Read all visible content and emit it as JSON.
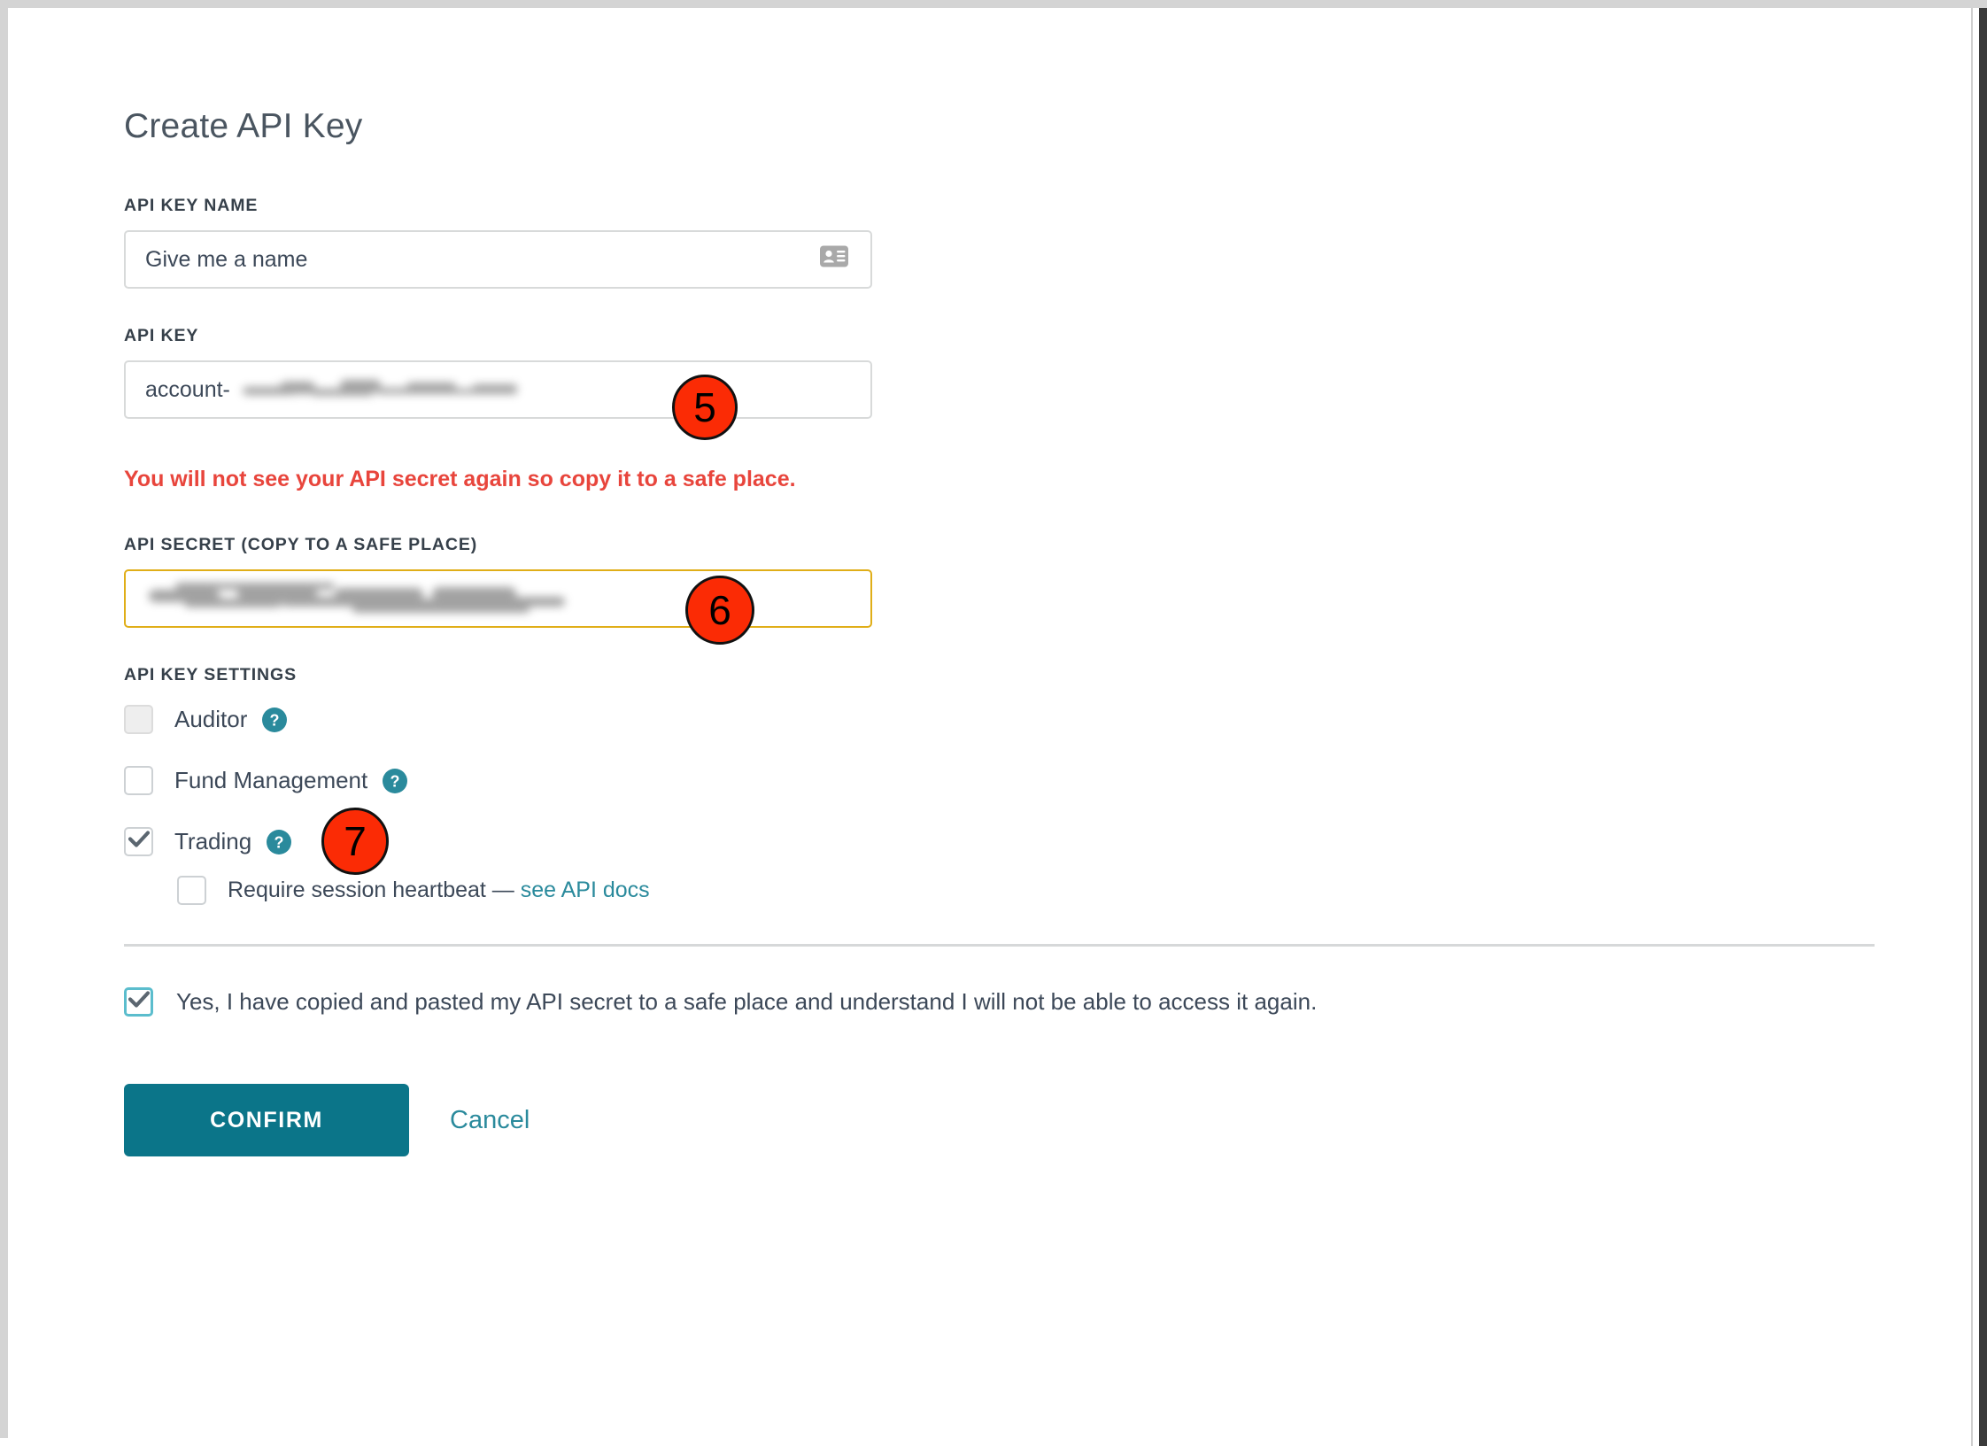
{
  "page": {
    "title": "Create API Key"
  },
  "fields": {
    "api_key_name": {
      "label": "API KEY NAME",
      "value": "Give me a name",
      "icon": "id-card-icon"
    },
    "api_key": {
      "label": "API KEY",
      "prefix": "account-",
      "value_redacted": true
    },
    "api_secret": {
      "label": "API SECRET (COPY TO A SAFE PLACE)",
      "value_redacted": true,
      "border_color": "#e0ae18"
    }
  },
  "warning": {
    "text": "You will not see your API secret again so copy it to a safe place.",
    "color": "#e8453c"
  },
  "settings": {
    "label": "API KEY SETTINGS",
    "options": [
      {
        "label": "Auditor",
        "checked": false,
        "disabled": true,
        "help": "help-icon"
      },
      {
        "label": "Fund Management",
        "checked": false,
        "disabled": false,
        "help": "help-icon"
      },
      {
        "label": "Trading",
        "checked": true,
        "disabled": false,
        "help": "help-icon"
      }
    ],
    "sub_option": {
      "label": "Require session heartbeat — ",
      "link_text": "see API docs",
      "checked": false
    }
  },
  "consent": {
    "label": "Yes, I have copied and pasted my API secret to a safe place and understand I will not be able to access it again.",
    "checked": true
  },
  "actions": {
    "confirm_label": "CONFIRM",
    "cancel_label": "Cancel",
    "confirm_color": "#0b7589",
    "cancel_color": "#2a8a9c"
  },
  "annotations": [
    {
      "number": "5",
      "target": "api-key-field"
    },
    {
      "number": "6",
      "target": "api-secret-field"
    },
    {
      "number": "7",
      "target": "trading-checkbox"
    }
  ]
}
